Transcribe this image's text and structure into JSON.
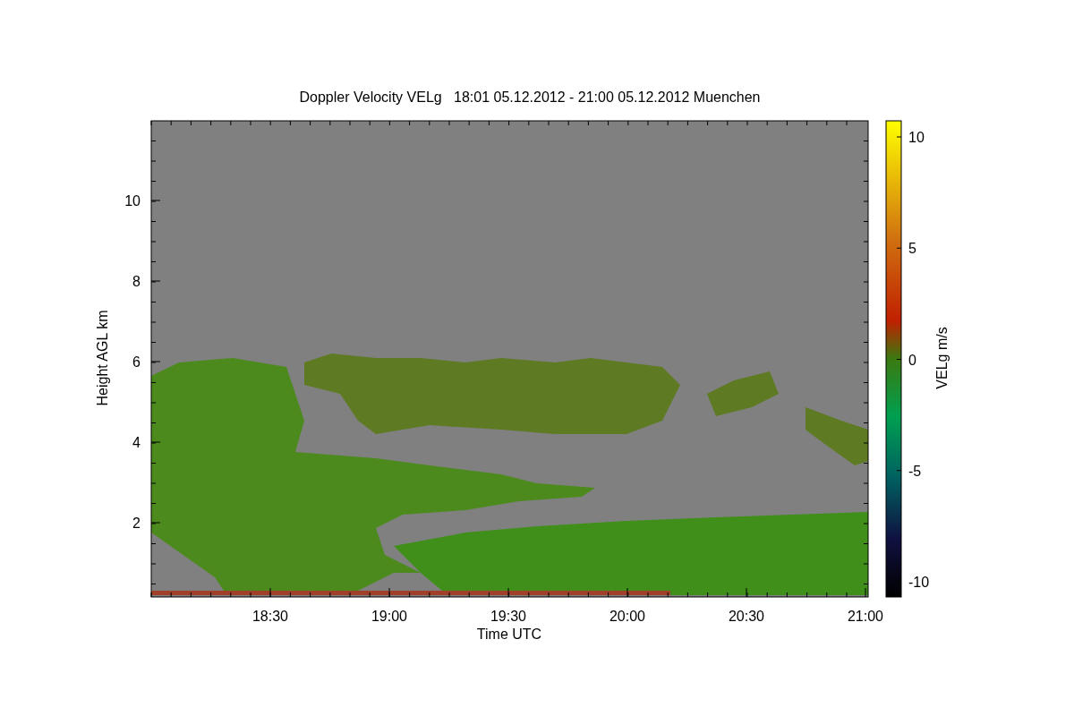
{
  "title": "Doppler Velocity VELg   18:01 05.12.2012 - 21:00 05.12.2012 Muenchen",
  "plot": {
    "xlabel": "Time UTC",
    "ylabel": "Height AGL km",
    "xticks": [
      "18:30",
      "19:00",
      "19:30",
      "20:00",
      "20:30",
      "21:00"
    ],
    "yticks": [
      "10",
      "8",
      "6",
      "4",
      "2"
    ]
  },
  "colorbar": {
    "label": "VELg m/s",
    "ticks": [
      "10",
      "5",
      "0",
      "-5",
      "-10"
    ]
  }
}
